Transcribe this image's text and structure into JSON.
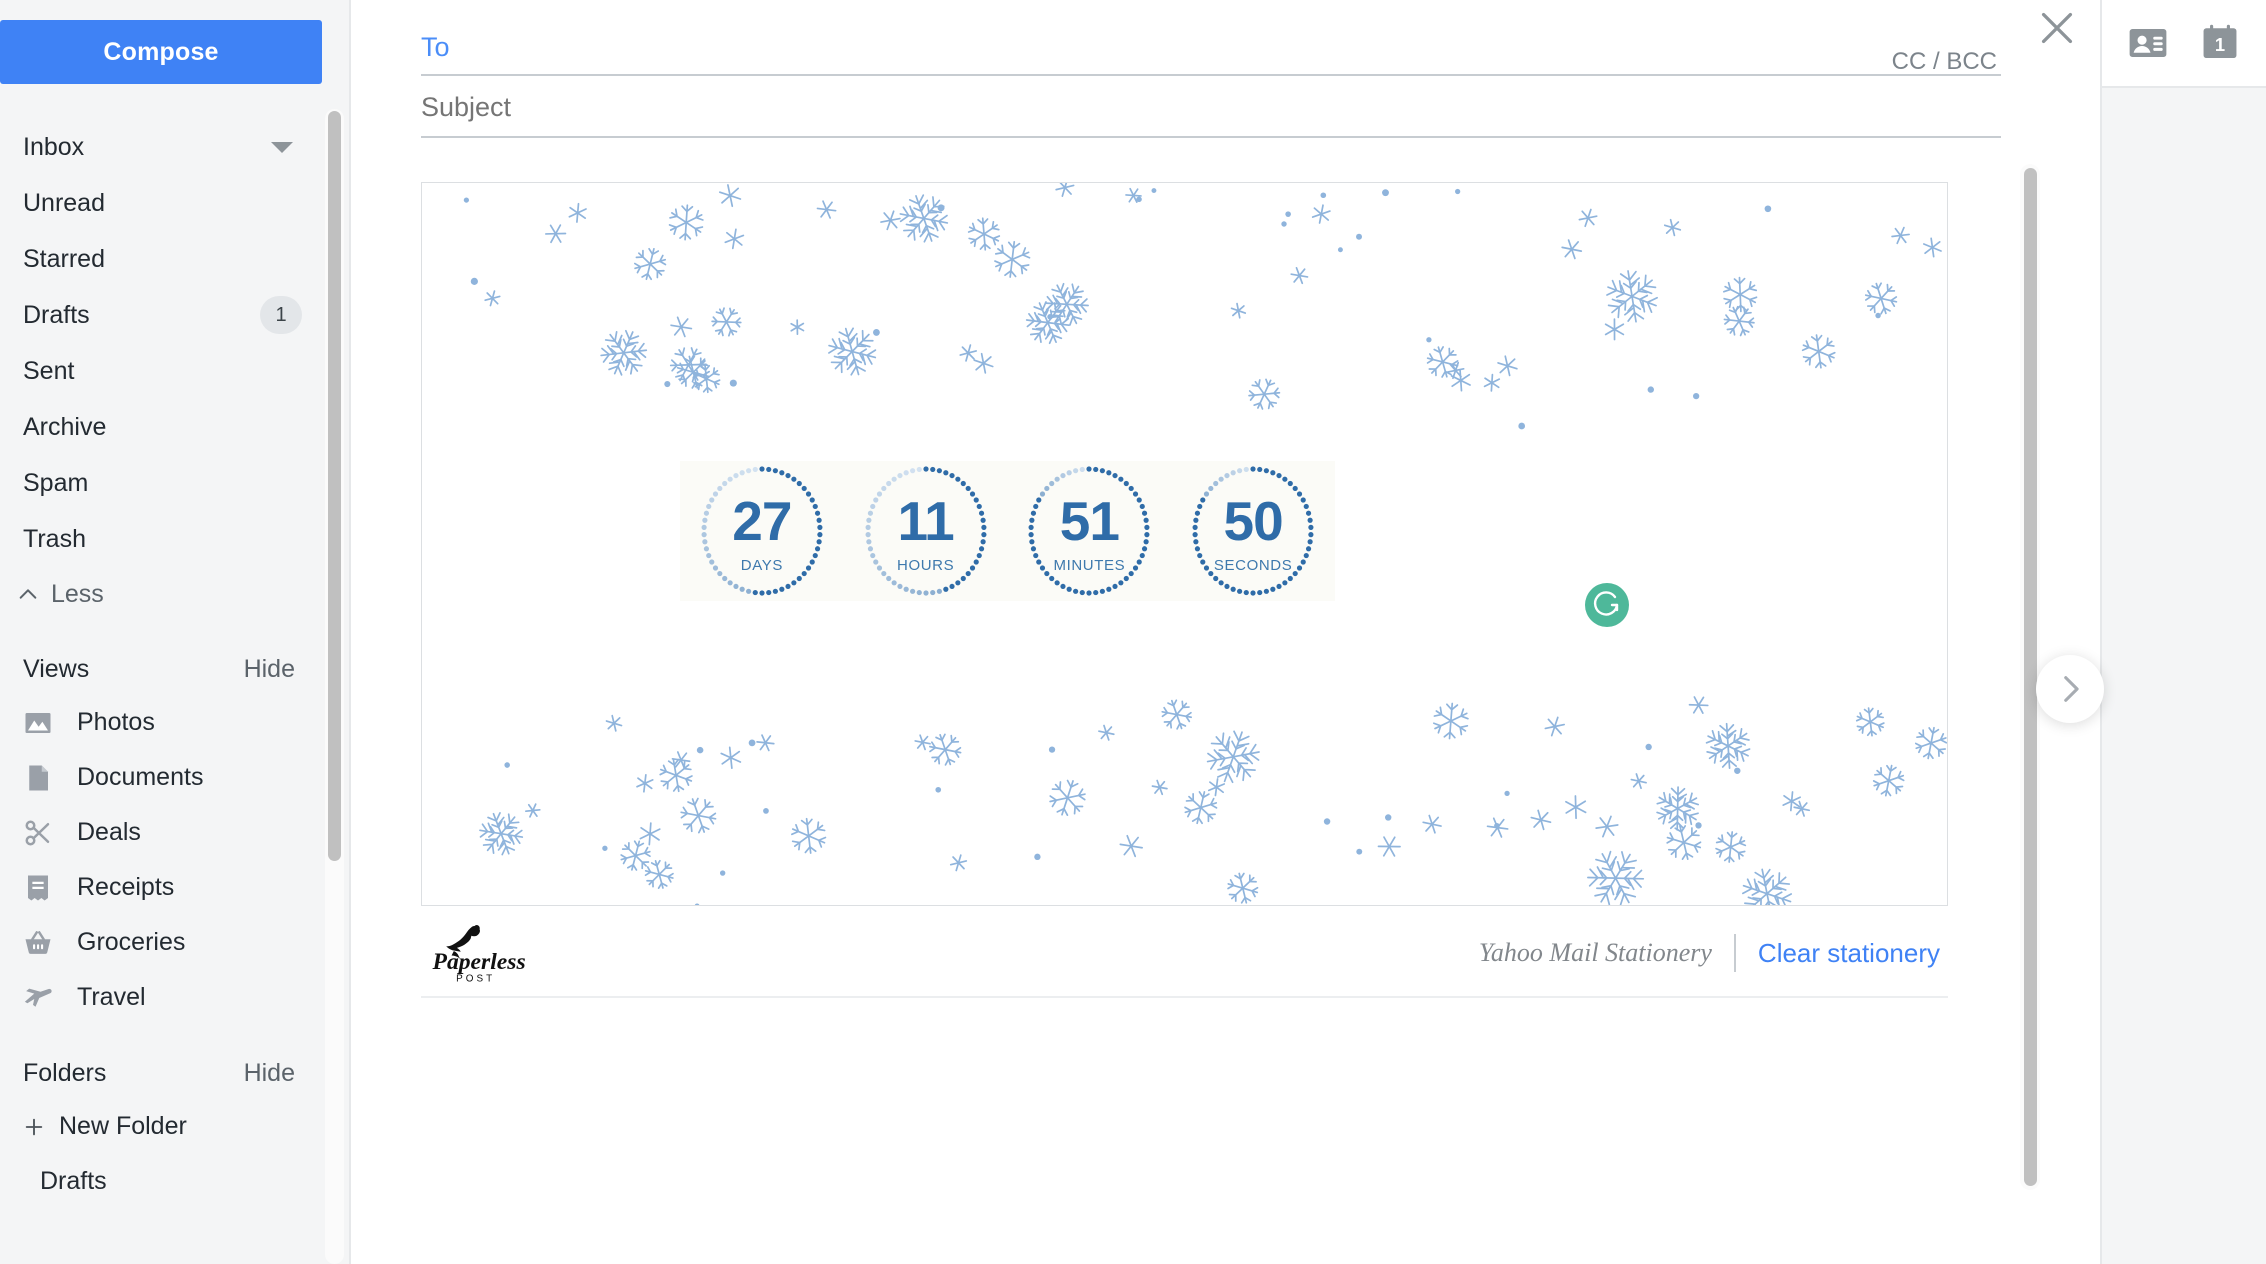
{
  "sidebar": {
    "compose_label": "Compose",
    "folders_nav": [
      {
        "label": "Inbox",
        "icon": "chevron-down-icon",
        "has_caret": true,
        "badge": ""
      },
      {
        "label": "Unread",
        "icon": "",
        "has_caret": false,
        "badge": ""
      },
      {
        "label": "Starred",
        "icon": "",
        "has_caret": false,
        "badge": ""
      },
      {
        "label": "Drafts",
        "icon": "",
        "has_caret": false,
        "badge": "1"
      },
      {
        "label": "Sent",
        "icon": "",
        "has_caret": false,
        "badge": ""
      },
      {
        "label": "Archive",
        "icon": "",
        "has_caret": false,
        "badge": ""
      },
      {
        "label": "Spam",
        "icon": "",
        "has_caret": false,
        "badge": ""
      },
      {
        "label": "Trash",
        "icon": "",
        "has_caret": false,
        "badge": ""
      }
    ],
    "less_label": "Less",
    "views": {
      "title": "Views",
      "hide_label": "Hide",
      "items": [
        {
          "label": "Photos",
          "icon": "photo-icon"
        },
        {
          "label": "Documents",
          "icon": "document-icon"
        },
        {
          "label": "Deals",
          "icon": "scissors-icon"
        },
        {
          "label": "Receipts",
          "icon": "receipt-icon"
        },
        {
          "label": "Groceries",
          "icon": "basket-icon"
        },
        {
          "label": "Travel",
          "icon": "airplane-icon"
        }
      ]
    },
    "folders": {
      "title": "Folders",
      "hide_label": "Hide",
      "new_folder_label": "New Folder",
      "items": [
        {
          "label": "Drafts"
        }
      ]
    }
  },
  "compose": {
    "to_value": "To",
    "to_placeholder": "To",
    "subject_value": "",
    "subject_placeholder": "Subject",
    "ccbcc_label": "CC / BCC",
    "close_icon": "close-icon"
  },
  "stationery": {
    "name": "Yahoo Mail Stationery",
    "clear_label": "Clear stationery",
    "brand": "Paperless",
    "brand_sub": "POST",
    "theme": "snowflakes",
    "snow_color": "#8fb4dc",
    "countdown": {
      "units": [
        {
          "value": "27",
          "label": "DAYS",
          "progress": 0.52
        },
        {
          "value": "11",
          "label": "HOURS",
          "progress": 0.46
        },
        {
          "value": "51",
          "label": "MINUTES",
          "progress": 0.85
        },
        {
          "value": "50",
          "label": "SECONDS",
          "progress": 0.84
        }
      ],
      "ring_color_dark": "#2f6ca8",
      "ring_color_light": "#d6e4f2",
      "number_color": "#2f6ca8",
      "panel_bg": "#fbfbf7"
    },
    "grammarly_icon": "grammarly-icon",
    "grammarly_color": "#4eb89a"
  },
  "right_rail": {
    "contacts_icon": "contacts-icon",
    "calendar_icon": "calendar-icon",
    "calendar_day": "1"
  },
  "next_button": {
    "icon": "chevron-right-icon"
  },
  "colors": {
    "accent": "#3f82f5",
    "sidebar_bg": "#f4f5f6",
    "text": "#232a31",
    "muted": "#6e767d"
  }
}
